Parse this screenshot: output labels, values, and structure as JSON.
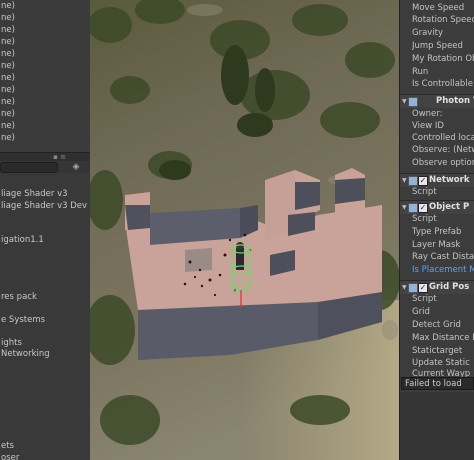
{
  "hierarchy": {
    "rows": [
      "ne)",
      "ne)",
      "ne)",
      "ne)",
      "ne)",
      "ne)",
      "ne)",
      "ne)",
      "ne)",
      "ne)",
      "ne)",
      "ne)"
    ]
  },
  "project": {
    "rows": [
      "liage Shader v3",
      "liage Shader v3 Dev",
      "igation1.1",
      "res pack",
      "e Systems",
      "ights",
      "Networking",
      "ets",
      "oser"
    ]
  },
  "inspector": {
    "fields_top": [
      "Move Speed",
      "Rotation Speed",
      "Gravity",
      "Jump Speed",
      "My Rotation Obj",
      "Run",
      "Is Controllable"
    ],
    "photon_view": {
      "title": "Photon V",
      "fields": [
        "Owner:",
        "View ID",
        "Controlled loca",
        "Observe: (Netw",
        "Observe option"
      ]
    },
    "network": {
      "title": "Network",
      "fields": [
        "Script"
      ]
    },
    "object_placer": {
      "title": "Object P",
      "fields": [
        "Script",
        "Type Prefab",
        "Layer Mask",
        "Ray Cast Distan"
      ],
      "link_field": "Is Placement M"
    },
    "grid_pos": {
      "title": "Grid Pos",
      "fields": [
        "Script",
        "Grid",
        "Detect Grid",
        "Max Distance D",
        "Statictarget",
        "Update Static",
        "Current Wayp"
      ]
    },
    "status_field": "Failed to load"
  },
  "colors": {
    "link": "#5fa0ff",
    "building_top": "#c9a39a",
    "building_side": "#5b5e6a",
    "gizmo": "#5ee05e"
  }
}
